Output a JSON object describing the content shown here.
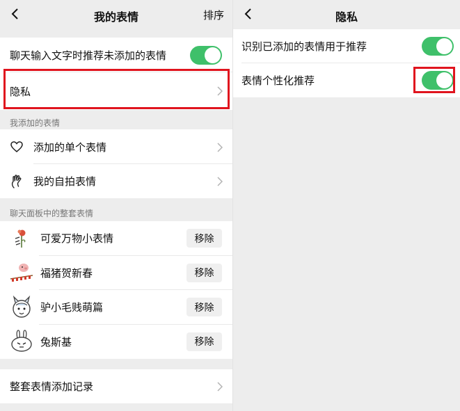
{
  "left": {
    "title": "我的表情",
    "action": "排序",
    "recommend_label": "聊天输入文字时推荐未添加的表情",
    "privacy_label": "隐私",
    "my_added_section": "我添加的表情",
    "single_stickers_label": "添加的单个表情",
    "selfie_stickers_label": "我的自拍表情",
    "panel_section": "聊天面板中的整套表情",
    "sticker_sets": [
      {
        "name": "可爱万物小表情",
        "remove": "移除"
      },
      {
        "name": "福猪贺新春",
        "remove": "移除"
      },
      {
        "name": "驴小毛贱萌篇",
        "remove": "移除"
      },
      {
        "name": "兔斯基",
        "remove": "移除"
      }
    ],
    "history_label": "整套表情添加记录"
  },
  "right": {
    "title": "隐私",
    "recognize_label": "识别已添加的表情用于推荐",
    "personalized_label": "表情个性化推荐"
  },
  "colors": {
    "toggle_on": "#3fc06a",
    "highlight": "#e0141e",
    "background": "#ededed"
  }
}
